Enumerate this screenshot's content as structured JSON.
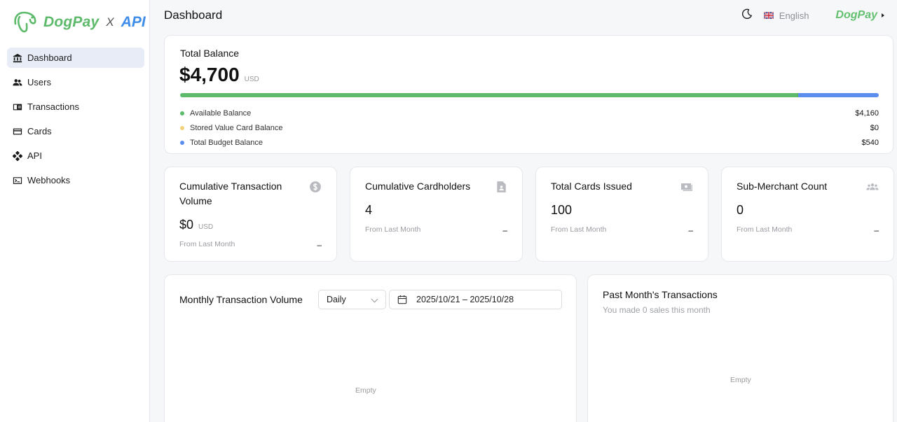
{
  "brand": {
    "name": "DogPay",
    "x": "X",
    "api": "API"
  },
  "sidebar": {
    "items": [
      {
        "label": "Dashboard",
        "icon": "bank-icon",
        "active": true
      },
      {
        "label": "Users",
        "icon": "users-icon",
        "active": false
      },
      {
        "label": "Transactions",
        "icon": "transactions-icon",
        "active": false
      },
      {
        "label": "Cards",
        "icon": "card-icon",
        "active": false
      },
      {
        "label": "API",
        "icon": "gamepad-icon",
        "active": false
      },
      {
        "label": "Webhooks",
        "icon": "terminal-icon",
        "active": false
      }
    ]
  },
  "header": {
    "title": "Dashboard",
    "language": "English",
    "brand_mini": "DogPay"
  },
  "balance": {
    "label": "Total Balance",
    "amount": "$4,700",
    "unit": "USD",
    "segments": [
      {
        "label": "Available Balance",
        "value": "$4,160",
        "amount": 4160,
        "color": "#5cba6a"
      },
      {
        "label": "Stored Value Card Balance",
        "value": "$0",
        "amount": 0,
        "color": "#f2d27a"
      },
      {
        "label": "Total Budget Balance",
        "value": "$540",
        "amount": 540,
        "color": "#5b8def"
      }
    ]
  },
  "stats": [
    {
      "title": "Cumulative Transaction Volume",
      "value": "$0",
      "unit": "USD",
      "foot": "From Last Month",
      "change": "–",
      "icon": "dollar-icon"
    },
    {
      "title": "Cumulative Cardholders",
      "value": "4",
      "unit": "",
      "foot": "From Last Month",
      "change": "–",
      "icon": "document-icon"
    },
    {
      "title": "Total Cards Issued",
      "value": "100",
      "unit": "",
      "foot": "From Last Month",
      "change": "–",
      "icon": "cards-stack-icon"
    },
    {
      "title": "Sub-Merchant Count",
      "value": "0",
      "unit": "",
      "foot": "From Last Month",
      "change": "–",
      "icon": "group-icon"
    }
  ],
  "monthly": {
    "title": "Monthly Transaction Volume",
    "period": "Daily",
    "range": "2025/10/21 – 2025/10/28",
    "empty": "Empty"
  },
  "past_month": {
    "title": "Past Month's Transactions",
    "subtitle": "You made 0 sales this month",
    "empty": "Empty"
  },
  "colors": {
    "accent": "#5cba6a",
    "api_blue": "#3f8de8",
    "active_nav": "#e8ecf7"
  }
}
